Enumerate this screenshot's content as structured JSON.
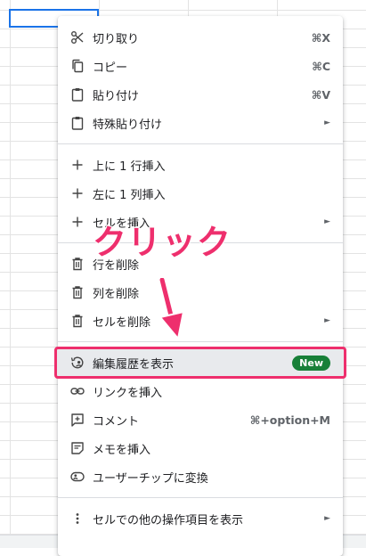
{
  "menu": {
    "items": [
      {
        "label": "切り取り",
        "shortcut": "⌘X",
        "icon": "scissors-icon"
      },
      {
        "label": "コピー",
        "shortcut": "⌘C",
        "icon": "copy-icon"
      },
      {
        "label": "貼り付け",
        "shortcut": "⌘V",
        "icon": "paste-icon"
      },
      {
        "label": "特殊貼り付け",
        "submenu": true,
        "icon": "paste-special-icon"
      },
      {
        "label": "上に 1 行挿入",
        "icon": "plus-icon"
      },
      {
        "label": "左に 1 列挿入",
        "icon": "plus-icon"
      },
      {
        "label": "セルを挿入",
        "submenu": true,
        "icon": "plus-icon"
      },
      {
        "label": "行を削除",
        "icon": "trash-icon"
      },
      {
        "label": "列を削除",
        "icon": "trash-icon"
      },
      {
        "label": "セルを削除",
        "submenu": true,
        "icon": "trash-icon"
      },
      {
        "label": "編集履歴を表示",
        "badge": "New",
        "icon": "history-icon",
        "highlighted": true
      },
      {
        "label": "リンクを挿入",
        "icon": "link-icon"
      },
      {
        "label": "コメント",
        "shortcut": "⌘+option+M",
        "icon": "comment-icon"
      },
      {
        "label": "メモを挿入",
        "icon": "note-icon"
      },
      {
        "label": "ユーザーチップに変換",
        "icon": "person-chip-icon"
      },
      {
        "label": "セルでの他の操作項目を表示",
        "submenu": true,
        "icon": "more-vertical-icon"
      }
    ],
    "submenu_arrow": "►"
  },
  "annotation": {
    "text": "クリック",
    "color": "#ee2f6d"
  },
  "colors": {
    "accent_selection": "#1a73e8",
    "highlight_border": "#ee2f6d",
    "badge_green": "#188038"
  }
}
